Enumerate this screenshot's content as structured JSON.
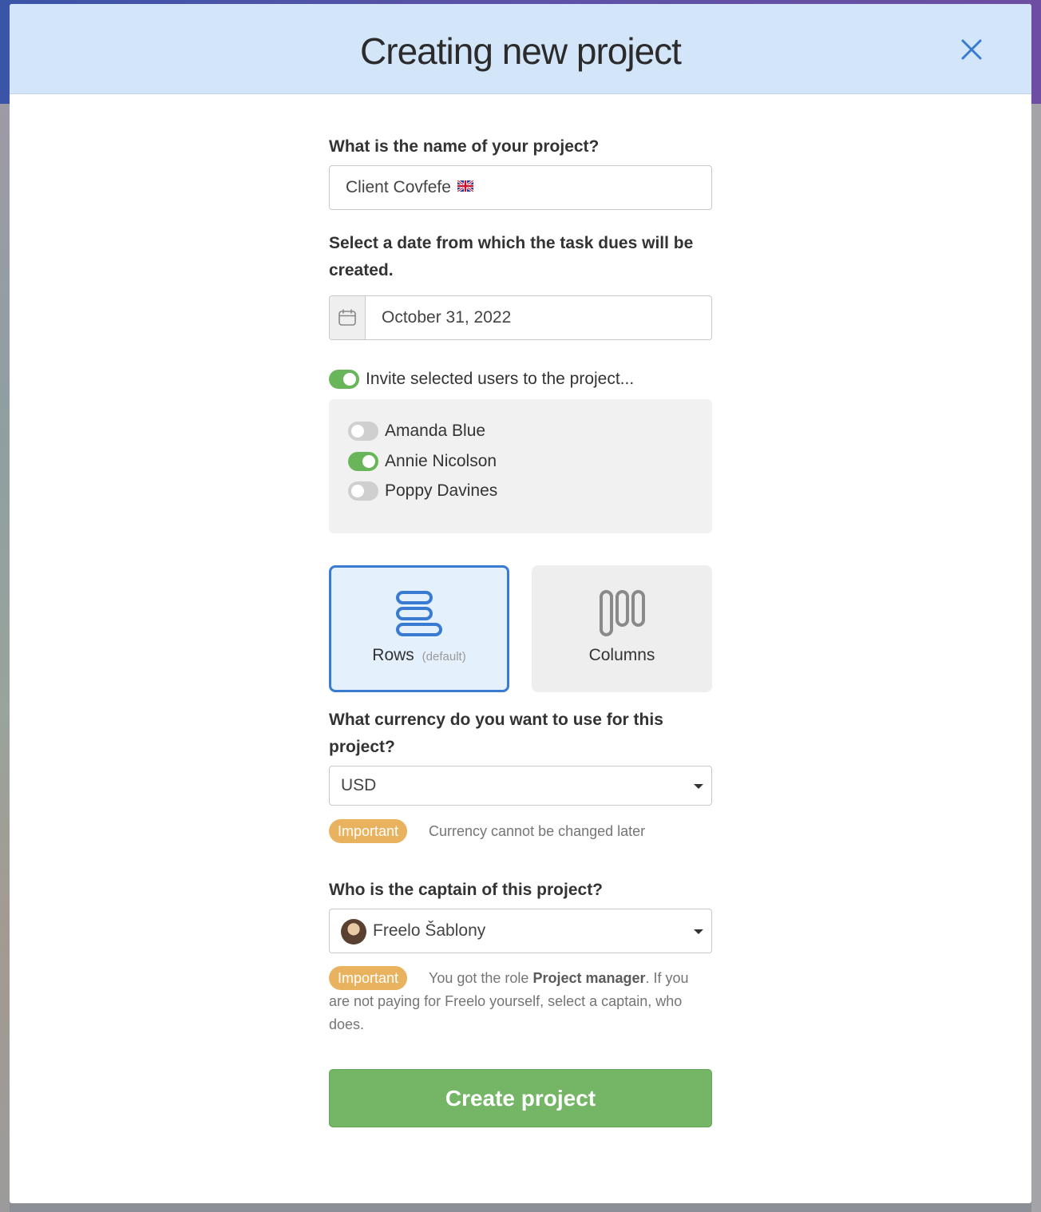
{
  "modal": {
    "title": "Creating new project"
  },
  "project_name": {
    "label": "What is the name of your project?",
    "value": "Client Covfefe"
  },
  "due_date": {
    "label": "Select a date from which the task dues will be created.",
    "value": "October 31, 2022"
  },
  "invite": {
    "label": "Invite selected users to the project...",
    "enabled": true,
    "users": [
      {
        "name": "Amanda Blue",
        "selected": false
      },
      {
        "name": "Annie Nicolson",
        "selected": true
      },
      {
        "name": "Poppy Davines",
        "selected": false
      }
    ]
  },
  "view": {
    "options": [
      {
        "label": "Rows",
        "suffix": "(default)",
        "selected": true,
        "icon": "rows-icon"
      },
      {
        "label": "Columns",
        "suffix": "",
        "selected": false,
        "icon": "columns-icon"
      }
    ]
  },
  "currency": {
    "label": "What currency do you want to use for this project?",
    "value": "USD",
    "badge": "Important",
    "note": "Currency cannot be changed later"
  },
  "captain": {
    "label": "Who is the captain of this project?",
    "value": "Freelo Šablony",
    "badge": "Important",
    "note_before": "You got the role ",
    "note_bold": "Project manager",
    "note_after": ". If you are not paying for Freelo yourself, select a captain, who does."
  },
  "submit": {
    "label": "Create project"
  },
  "colors": {
    "header_bg": "#d3e5f8",
    "accent_blue": "#3a7bd2",
    "toggle_on": "#69b55a",
    "badge": "#e9b25e",
    "primary_button": "#74b666"
  }
}
